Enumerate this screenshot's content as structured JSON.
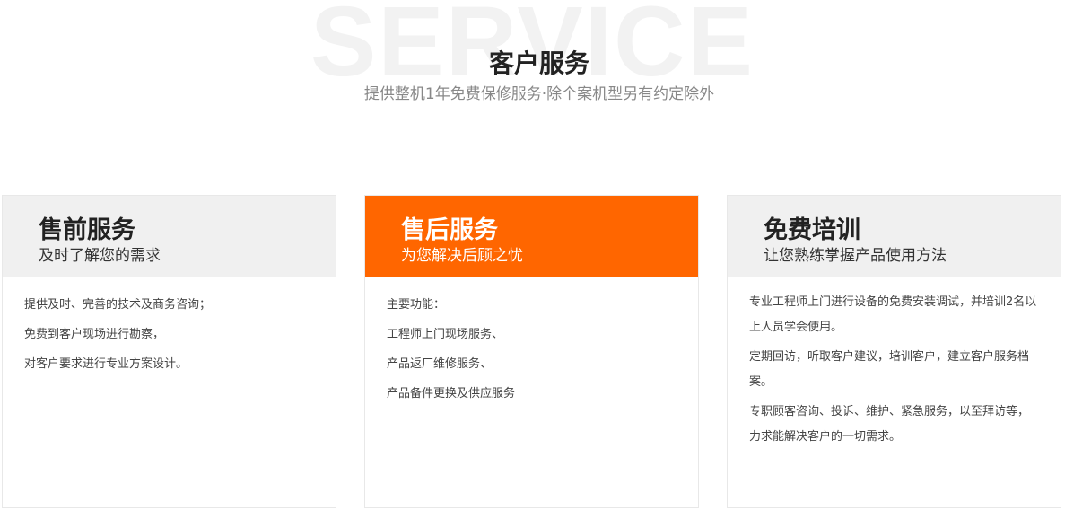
{
  "header": {
    "watermark": "SERVICE",
    "title": "客户服务",
    "subtitle": "提供整机1年免费保修服务·除个案机型另有约定除外"
  },
  "cards": [
    {
      "title": "售前服务",
      "subtitle": "及时了解您的需求",
      "lines": [
        "提供及时、完善的技术及商务咨询；",
        "免费到客户现场进行勘察，",
        "对客户要求进行专业方案设计。"
      ]
    },
    {
      "title": "售后服务",
      "subtitle": "为您解决后顾之忧",
      "lines": [
        "主要功能：",
        "工程师上门现场服务、",
        "产品返厂维修服务、",
        "产品备件更换及供应服务"
      ]
    },
    {
      "title": "免费培训",
      "subtitle": "让您熟练掌握产品使用方法",
      "lines": [
        "专业工程师上门进行设备的免费安装调试，并培训2名以上人员学会使用。",
        "定期回访，听取客户建议，培训客户，建立客户服务档案。",
        "专职顾客咨询、投诉、维护、紧急服务，以至拜访等，力求能解决客户的一切需求。"
      ]
    }
  ],
  "colors": {
    "accent": "#ff6600",
    "card_head": "#f0f0f0",
    "watermark": "#f2f2f2"
  }
}
